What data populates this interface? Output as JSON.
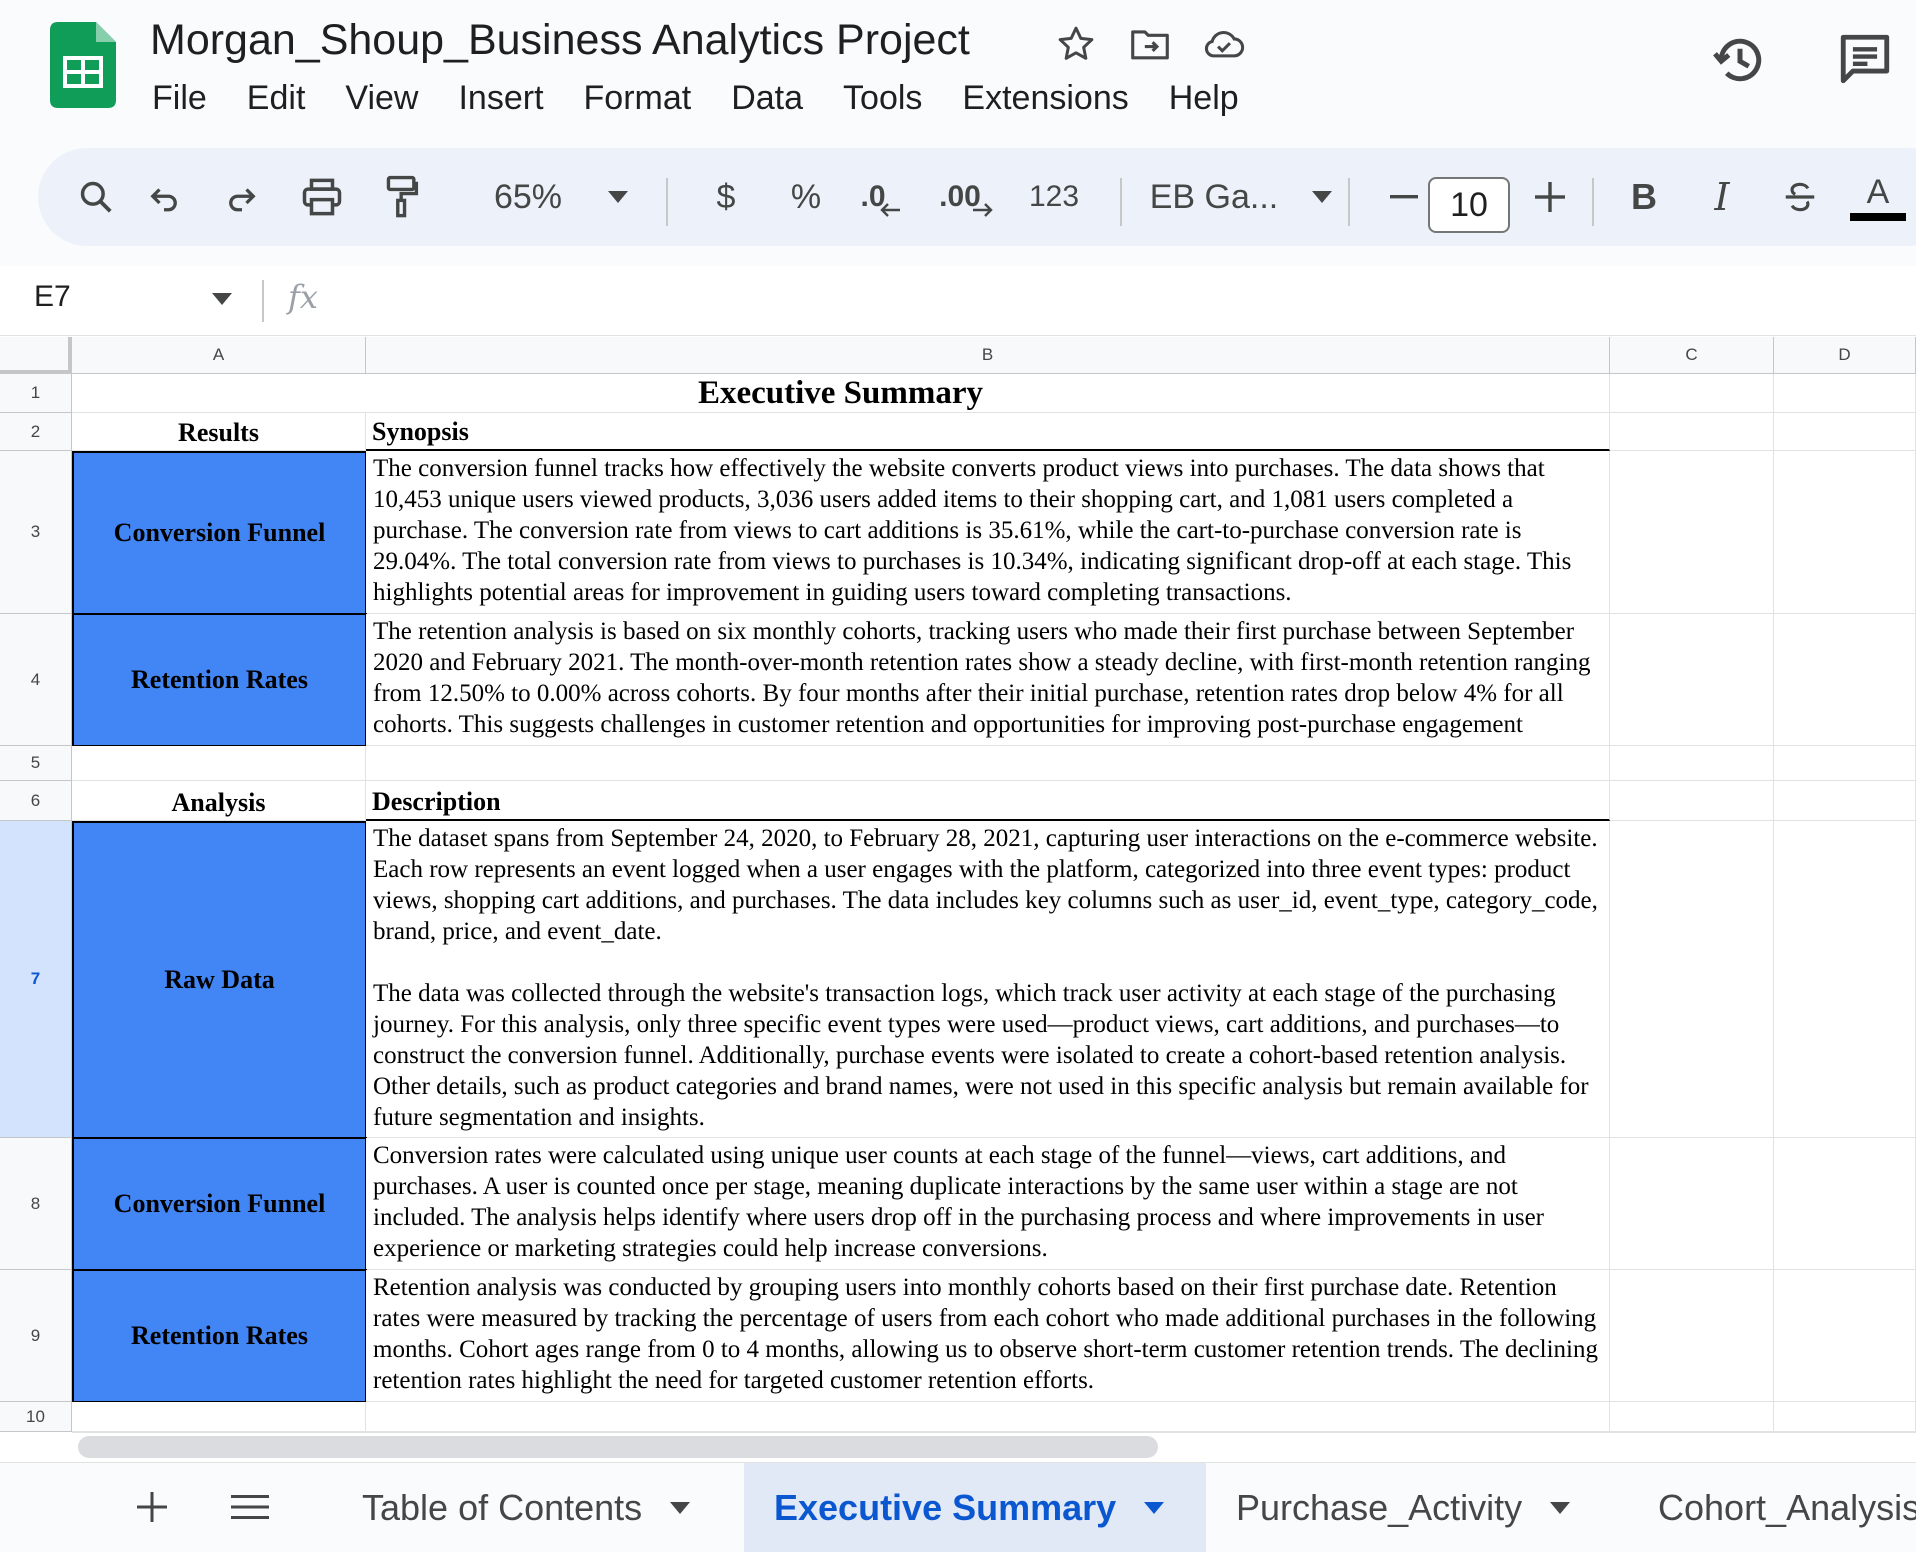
{
  "app": {
    "doc_title": "Morgan_Shoup_Business Analytics Project"
  },
  "menu": [
    "File",
    "Edit",
    "View",
    "Insert",
    "Format",
    "Data",
    "Tools",
    "Extensions",
    "Help"
  ],
  "toolbar": {
    "zoom": "65%",
    "currency": "$",
    "percent": "%",
    "decrease_decimal": ".0",
    "increase_decimal": ".00",
    "number_format": "123",
    "font": "EB Ga...",
    "font_size": "10",
    "text_color": "#000000"
  },
  "formula_bar": {
    "cell_ref": "E7",
    "fx": "fx",
    "value": ""
  },
  "columns": [
    "A",
    "B",
    "C",
    "D"
  ],
  "rows": [
    "1",
    "2",
    "3",
    "4",
    "5",
    "6",
    "7",
    "8",
    "9",
    "10"
  ],
  "selected_row": "7",
  "sheet": {
    "title": "Executive Summary",
    "results_header": "Results",
    "synopsis_header": "Synopsis",
    "analysis_header": "Analysis",
    "description_header": "Description",
    "results": [
      {
        "label": "Conversion Funnel",
        "text": "The conversion funnel tracks how effectively the website converts product views into purchases. The data shows that 10,453 unique users viewed products, 3,036 users added items to their shopping cart, and 1,081 users completed a purchase. The conversion rate from views to cart additions is 35.61%, while the cart-to-purchase conversion rate is 29.04%. The total conversion rate from views to purchases is 10.34%, indicating significant drop-off at each stage. This highlights potential areas for improvement in guiding users toward completing transactions."
      },
      {
        "label": "Retention Rates",
        "text": "The retention analysis is based on six monthly cohorts, tracking users who made their first purchase between September 2020 and February 2021. The month-over-month retention rates show a steady decline, with first-month retention ranging from 12.50% to 0.00% across cohorts. By four months after their initial purchase, retention rates drop below 4% for all cohorts. This suggests challenges in customer retention and opportunities for improving post-purchase engagement strategies."
      }
    ],
    "analysis": [
      {
        "label": "Raw Data",
        "text": "The dataset spans from September 24, 2020, to February 28, 2021, capturing user interactions on the e-commerce website. Each row represents an event logged when a user engages with the platform, categorized into three event types: product views, shopping cart additions, and purchases. The data includes key columns such as user_id, event_type, category_code, brand, price, and event_date.\n\nThe data was collected through the website's transaction logs, which track user activity at each stage of the purchasing journey. For this analysis, only three specific event types were used—product views, cart additions, and purchases—to construct the conversion funnel. Additionally, purchase events were isolated to create a cohort-based retention analysis. Other details, such as product categories and brand names, were not used in this specific analysis but remain available for future segmentation and insights."
      },
      {
        "label": "Conversion Funnel",
        "text": "Conversion rates were calculated using unique user counts at each stage of the funnel—views, cart additions, and purchases. A user is counted once per stage, meaning duplicate interactions by the same user within a stage are not included. The analysis helps identify where users drop off in the purchasing process and where improvements in user experience or marketing strategies could help increase conversions."
      },
      {
        "label": "Retention Rates",
        "text": "Retention analysis was conducted by grouping users into monthly cohorts based on their first purchase date. Retention rates were measured by tracking the percentage of users from each cohort who made additional purchases in the following months. Cohort ages range from 0 to 4 months, allowing us to observe short-term customer retention trends. The declining retention rates highlight the need for targeted customer retention efforts."
      }
    ]
  },
  "tabs": [
    {
      "label": "Table of Contents",
      "active": false
    },
    {
      "label": "Executive Summary",
      "active": true
    },
    {
      "label": "Purchase_Activity",
      "active": false
    },
    {
      "label": "Cohort_Analysis",
      "active": false
    }
  ],
  "colors": {
    "accent_blue": "#4285f4",
    "tab_active_text": "#0b57d0",
    "sheets_green": "#0f9d58"
  }
}
